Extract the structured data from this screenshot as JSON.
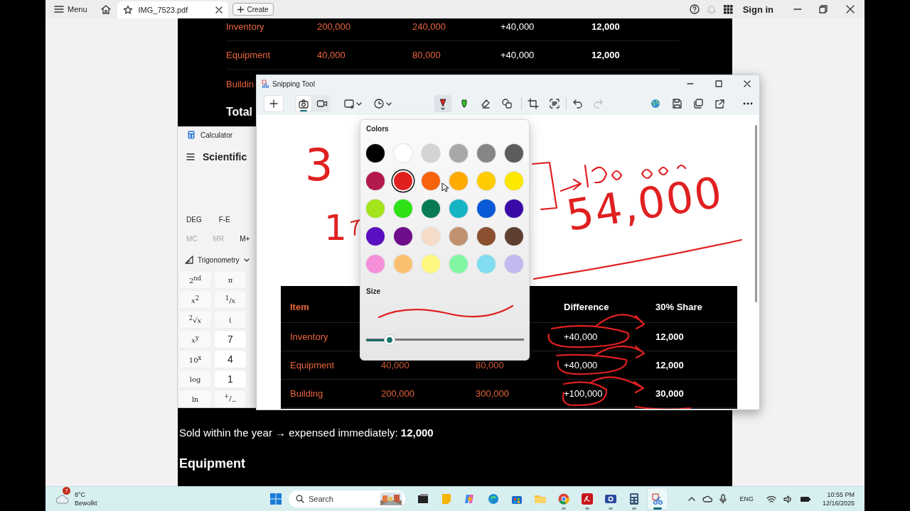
{
  "browser": {
    "menu_label": "Menu",
    "tabs": [
      {
        "title": "IMG_7523.pdf",
        "selected": true
      }
    ],
    "create_label": "Create",
    "notifications": {
      "disabled": true
    },
    "sign_in": "Sign in"
  },
  "document": {
    "rows": [
      {
        "item": "Inventory",
        "column_2": "200,000",
        "column_3": "240,000",
        "difference": "+40,000",
        "share": "12,000"
      },
      {
        "item": "Equipment",
        "column_2": "40,000",
        "column_3": "80,000",
        "difference": "+40,000",
        "share": "12,000"
      },
      {
        "item": "Buildin"
      }
    ],
    "total_label": "Total",
    "sentence": "Sold within the year → expensed immediately: **12,000**",
    "heading": "Equipment"
  },
  "calculator": {
    "title": "Calculator",
    "mode": "Scientific",
    "angle_unit": "DEG",
    "notation": "F-E",
    "memory": [
      {
        "label": "MC",
        "disabled": true
      },
      {
        "label": "MR",
        "disabled": true
      },
      {
        "label": "M+",
        "disabled": false
      }
    ],
    "function_menu": "Trigonometry",
    "keys": [
      {
        "label": "2$^{nd}$",
        "kind": "function"
      },
      {
        "label": "π",
        "kind": "function"
      },
      {
        "label": "*x*$^{2}$",
        "kind": "function"
      },
      {
        "label": "$^{1}$/*x*",
        "kind": "function"
      },
      {
        "label": "$^{2}$√*x*",
        "kind": "function"
      },
      {
        "label": "(",
        "kind": "function"
      },
      {
        "label": "*x*$^{y}$",
        "kind": "function"
      },
      {
        "label": "7",
        "kind": "digit"
      },
      {
        "label": "10$^{x}$",
        "kind": "function"
      },
      {
        "label": "4",
        "kind": "digit"
      },
      {
        "label": "log",
        "kind": "function"
      },
      {
        "label": "1",
        "kind": "digit"
      },
      {
        "label": "ln",
        "kind": "function"
      },
      {
        "label": "$^{+}$/$_{−}$",
        "kind": "function"
      }
    ]
  },
  "snipping_tool": {
    "title": "Snipping Tool",
    "capture_modes": [
      {
        "selected": true
      },
      {
        "selected": false
      }
    ],
    "markup_tools": [
      {
        "selected": true
      },
      {
        "selected": false
      },
      {
        "selected": false
      },
      {
        "selected": false
      }
    ],
    "history": [
      {
        "disabled": false
      },
      {
        "disabled": true
      }
    ],
    "canvas": {
      "handwriting": [
        {
          "text": "3"
        },
        {
          "text": "1"
        },
        {
          "text": "54,000"
        }
      ],
      "table": {
        "header": {
          "item": "Item",
          "difference": "Difference",
          "share": "30% Share"
        },
        "rows": [
          {
            "item": "Inventory",
            "difference": "+40,000",
            "share": "12,000"
          },
          {
            "item": "Equipment",
            "column_2": "40,000",
            "column_3": "80,000",
            "difference": "+40,000",
            "share": "12,000"
          },
          {
            "item": "Building",
            "column_2": "200,000",
            "column_3": "300,000",
            "difference": "+100,000",
            "share": "30,000"
          }
        ]
      }
    },
    "color_picker": {
      "title": "Colors",
      "colors": [
        {
          "color": "#000000",
          "selected": false
        },
        {
          "color": "#ffffff",
          "selected": false
        },
        {
          "color": "#d4d4d4",
          "selected": false
        },
        {
          "color": "#a8a8a8",
          "selected": false
        },
        {
          "color": "#868686",
          "selected": false
        },
        {
          "color": "#5c5c5c",
          "selected": false
        },
        {
          "color": "#b3194e",
          "selected": false
        },
        {
          "color": "#e0201e",
          "selected": true
        },
        {
          "color": "#f7630c",
          "selected": false
        },
        {
          "color": "#ffaa00",
          "selected": false
        },
        {
          "color": "#ffcc00",
          "selected": false
        },
        {
          "color": "#fde800",
          "selected": false
        },
        {
          "color": "#a4e41c",
          "selected": false
        },
        {
          "color": "#2ee216",
          "selected": false
        },
        {
          "color": "#0a7a55",
          "selected": false
        },
        {
          "color": "#16b4c4",
          "selected": false
        },
        {
          "color": "#0a5ad8",
          "selected": false
        },
        {
          "color": "#3a0aa8",
          "selected": false
        },
        {
          "color": "#5a10c0",
          "selected": false
        },
        {
          "color": "#6e0e8a",
          "selected": false
        },
        {
          "color": "#f5dcc8",
          "selected": false
        },
        {
          "color": "#c09270",
          "selected": false
        },
        {
          "color": "#8a5030",
          "selected": false
        },
        {
          "color": "#5e4030",
          "selected": false
        },
        {
          "color": "#f590d8",
          "selected": false
        },
        {
          "color": "#fcc070",
          "selected": false
        },
        {
          "color": "#fef880",
          "selected": false
        },
        {
          "color": "#80f7a0",
          "selected": false
        },
        {
          "color": "#80dcf0",
          "selected": false
        },
        {
          "color": "#c4b8f0",
          "selected": false
        }
      ],
      "size": {
        "label": "Size",
        "level": 0.15
      }
    }
  },
  "taskbar": {
    "weather": {
      "badge": "7",
      "temperature": "8°C",
      "condition": "Bewolkt"
    },
    "search": {
      "placeholder": "Search"
    },
    "apps": [
      {
        "running": false,
        "active": false
      },
      {
        "running": false,
        "active": false
      },
      {
        "running": false,
        "active": false
      },
      {
        "running": false,
        "active": false
      },
      {
        "running": false,
        "active": false
      },
      {
        "running": false,
        "active": false
      },
      {
        "running": true,
        "active": false
      },
      {
        "running": true,
        "active": false
      },
      {
        "running": true,
        "active": false
      },
      {
        "running": true,
        "active": false
      },
      {
        "running": true,
        "active": true
      }
    ],
    "language": "ENG",
    "time": "10:55 PM",
    "date": "12/16/2025"
  }
}
